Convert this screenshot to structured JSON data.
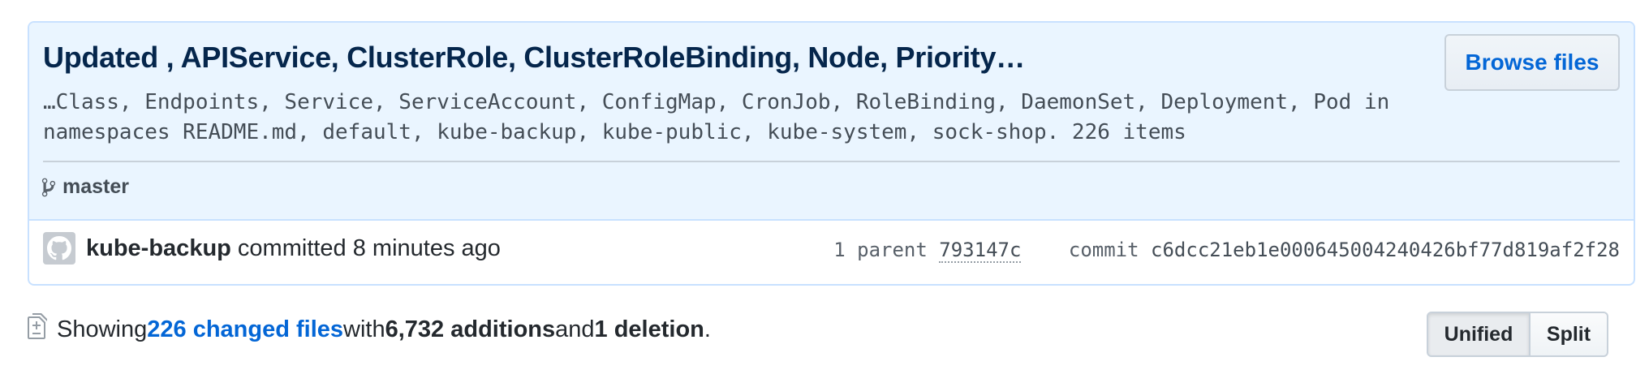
{
  "commit": {
    "title": "Updated , APIService, ClusterRole, ClusterRoleBinding, Node, Priority…",
    "description": "…Class, Endpoints, Service, ServiceAccount, ConfigMap, CronJob, RoleBinding, DaemonSet, Deployment, Pod in\nnamespaces README.md, default, kube-backup, kube-public, kube-system, sock-shop. 226 items",
    "browse_files_label": "Browse files",
    "branch": "master",
    "branch_icon": "git-branch-icon",
    "author": "kube-backup",
    "committed_text": " committed 8 minutes ago",
    "parent_label": "1 parent",
    "parent_sha": "793147c",
    "commit_label": "commit",
    "commit_sha": "c6dcc21eb1e000645004240426bf77d819af2f28"
  },
  "summary": {
    "prefix": "Showing ",
    "changed_files": "226 changed files",
    "with": " with ",
    "additions": "6,732 additions",
    "and": " and ",
    "deletions": "1 deletion",
    "suffix": "."
  },
  "view_toggle": {
    "unified_label": "Unified",
    "split_label": "Split",
    "selected": "Unified"
  },
  "colors": {
    "header_bg": "#eaf5ff",
    "border": "#c8e1ff",
    "title": "#05264c",
    "link": "#0366d6"
  }
}
